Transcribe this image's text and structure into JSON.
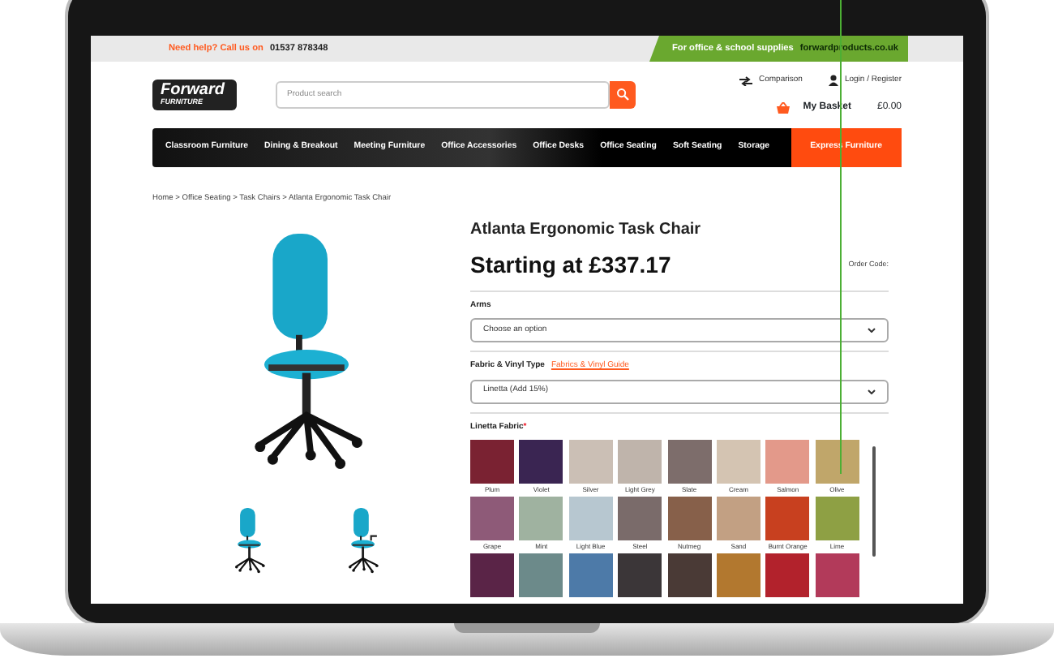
{
  "top_bar": {
    "help_text": "Need help? Call us on",
    "phone": "01537 878348",
    "promo_text": "For office & school supplies",
    "promo_site": "forwardproducts.co.uk"
  },
  "logo": {
    "line1": "Forward",
    "line2": "FURNITURE"
  },
  "search": {
    "placeholder": "Product search"
  },
  "header_links": [
    "Comparison",
    "Login / Register"
  ],
  "basket": {
    "label": "My Basket",
    "amount": "£0.00"
  },
  "nav": [
    {
      "label": "Classroom Furniture",
      "kind": "normal"
    },
    {
      "label": "Dining & Breakout",
      "kind": "normal"
    },
    {
      "label": "Meeting Furniture",
      "kind": "normal"
    },
    {
      "label": "Office Accessories",
      "kind": "normal"
    },
    {
      "label": "Office Desks",
      "kind": "normal"
    },
    {
      "label": "Office Seating",
      "kind": "normal"
    },
    {
      "label": "Soft Seating",
      "kind": "normal"
    },
    {
      "label": "Storage",
      "kind": "normal"
    },
    {
      "label": "Express Furniture",
      "kind": "express"
    }
  ],
  "breadcrumb": "Home > Office Seating > Task Chairs > Atlanta Ergonomic Task Chair",
  "gallery": {
    "thumbnails": [
      {
        "kind": "no-arms"
      },
      {
        "kind": "arms"
      }
    ]
  },
  "product": {
    "title": "Atlanta Ergonomic Task Chair",
    "price": "Starting at £337.17",
    "order_code": "Order Code:"
  },
  "options": [
    {
      "label": "Arms",
      "value": "Choose an option"
    },
    {
      "label": "Fabric & Vinyl Type",
      "link": "Fabrics & Vinyl Guide",
      "value": "Linetta (Add 15%)"
    }
  ],
  "fabric": {
    "label": "Linetta Fabric",
    "required_mark": "*",
    "swatches": [
      {
        "name": "Plum",
        "color": "#7a2232"
      },
      {
        "name": "Violet",
        "color": "#3a2552"
      },
      {
        "name": "Silver",
        "color": "#cbbfb5"
      },
      {
        "name": "Light Grey",
        "color": "#bfb4ab"
      },
      {
        "name": "Slate",
        "color": "#7d6d6b"
      },
      {
        "name": "Cream",
        "color": "#d4c4b2"
      },
      {
        "name": "Salmon",
        "color": "#e3998a"
      },
      {
        "name": "Olive",
        "color": "#c0a66a"
      },
      {
        "name": "Grape",
        "color": "#8e5a78"
      },
      {
        "name": "Mint",
        "color": "#9fb2a0"
      },
      {
        "name": "Light Blue",
        "color": "#b7c7d0"
      },
      {
        "name": "Steel",
        "color": "#7a6b6a"
      },
      {
        "name": "Nutmeg",
        "color": "#87604a"
      },
      {
        "name": "Sand",
        "color": "#c2a083"
      },
      {
        "name": "Burnt Orange",
        "color": "#c8401f"
      },
      {
        "name": "Lime",
        "color": "#8ea044"
      },
      {
        "color": "#5a2447"
      },
      {
        "color": "#6c8a8a"
      },
      {
        "color": "#4d7aa8"
      },
      {
        "color": "#3b3638"
      },
      {
        "color": "#4a3a36"
      },
      {
        "color": "#b2782f"
      },
      {
        "color": "#b2222c"
      },
      {
        "color": "#b23a5a"
      }
    ]
  }
}
